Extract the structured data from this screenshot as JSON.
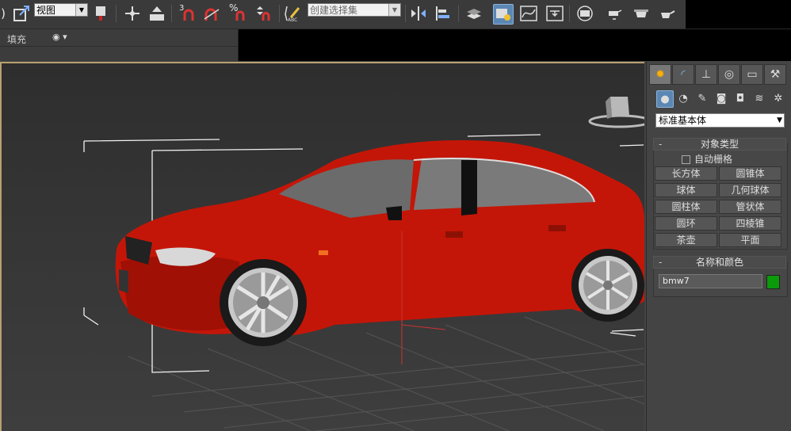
{
  "toolbar": {
    "view_dropdown": "视图",
    "selection_set_dropdown": "创建选择集",
    "snap_angle_label": "3",
    "percent_snap_label": "%",
    "spinner_snap_label": "",
    "icons": [
      "select-and-move-icon",
      "view-dropdown",
      "select-and-manipulate-icon",
      "move-icon",
      "place-icon",
      "snap-toggle-icon",
      "angle-snap-icon",
      "percent-snap-icon",
      "spinner-snap-icon",
      "edit-named-selection-icon",
      "mirror-icon",
      "align-icon",
      "layer-manager-icon",
      "scene-explorer-icon",
      "curve-editor-icon",
      "schematic-view-icon",
      "material-editor-icon",
      "render-setup-icon",
      "rendered-frame-icon",
      "render-icon"
    ]
  },
  "ribbon": {
    "fill_label": "填充"
  },
  "command_panel": {
    "tabs": [
      "create",
      "modify",
      "hierarchy",
      "motion",
      "display",
      "utilities"
    ],
    "subcategories": [
      "geometry",
      "shapes",
      "lights",
      "cameras",
      "helpers",
      "space-warps",
      "systems"
    ],
    "category": "标准基本体",
    "object_type": {
      "title": "对象类型",
      "autogrid_label": "自动栅格",
      "autogrid_checked": false,
      "buttons": [
        "长方体",
        "圆锥体",
        "球体",
        "几何球体",
        "圆柱体",
        "管状体",
        "圆环",
        "四棱锥",
        "茶壶",
        "平面"
      ]
    },
    "name_and_color": {
      "title": "名称和颜色",
      "name": "bmw7",
      "color": "#0a9a0a"
    }
  },
  "viewport": {
    "object_name": "bmw7",
    "object_color": "#c41608"
  }
}
